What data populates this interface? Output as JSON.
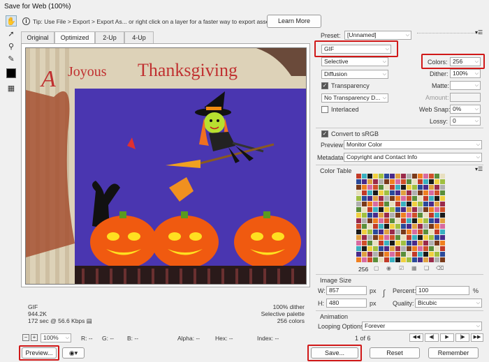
{
  "window": {
    "title": "Save for Web (100%)"
  },
  "tip": {
    "text": "Tip: Use File > Export > Export As...  or right click on a layer for a faster way to export assets",
    "learn_more": "Learn More"
  },
  "tabs": [
    {
      "label": "Original"
    },
    {
      "label": "Optimized",
      "active": true
    },
    {
      "label": "2-Up"
    },
    {
      "label": "4-Up"
    }
  ],
  "image_stats": {
    "format": "GIF",
    "size": "944.2K",
    "time": "172 sec @ 56.6 Kbps",
    "dither": "100% dither",
    "palette": "Selective palette",
    "colors": "256 colors"
  },
  "status_bar": {
    "zoom": "100%",
    "r": "R: --",
    "g": "G: --",
    "b": "B: --",
    "alpha": "Alpha: --",
    "hex": "Hex: --",
    "index": "Index: --"
  },
  "bottom_buttons": {
    "preview": "Preview...",
    "save": "Save...",
    "reset": "Reset",
    "remember": "Remember"
  },
  "settings": {
    "preset_label": "Preset:",
    "preset_value": "[Unnamed]",
    "format": "GIF",
    "reduction": "Selective",
    "colors_label": "Colors:",
    "colors_value": "256",
    "dither_algo": "Diffusion",
    "dither_label": "Dither:",
    "dither_value": "100%",
    "transparency_label": "Transparency",
    "transparency_checked": true,
    "matte_label": "Matte:",
    "transparency_dither": "No Transparency D...",
    "amount_label": "Amount:",
    "interlaced_label": "Interlaced",
    "interlaced_checked": false,
    "websnap_label": "Web Snap:",
    "websnap_value": "0%",
    "lossy_label": "Lossy:",
    "lossy_value": "0",
    "convert_srgb_label": "Convert to sRGB",
    "convert_srgb_checked": true,
    "preview_label": "Preview:",
    "preview_value": "Monitor Color",
    "metadata_label": "Metadata:",
    "metadata_value": "Copyright and Contact Info"
  },
  "color_table": {
    "title": "Color Table",
    "count": "256",
    "colors": [
      "#c23a28",
      "#e0a040",
      "#5a8e3a",
      "#2a4a9a",
      "#d86aa0",
      "#f0d040",
      "#7a3a1a",
      "#3ab0c0",
      "#9a2a4a",
      "#e8e0c0",
      "#4a2a8a",
      "#d0502a",
      "#a0c040",
      "#f08020",
      "#1a1a1a",
      "#b0b0b0"
    ]
  },
  "image_size": {
    "title": "Image Size",
    "w_label": "W:",
    "w_value": "857",
    "h_label": "H:",
    "h_value": "480",
    "unit": "px",
    "percent_label": "Percent:",
    "percent_value": "100",
    "percent_unit": "%",
    "quality_label": "Quality:",
    "quality_value": "Bicubic"
  },
  "animation": {
    "title": "Animation",
    "looping_label": "Looping Options:",
    "looping_value": "Forever",
    "frame": "1 of 6"
  }
}
